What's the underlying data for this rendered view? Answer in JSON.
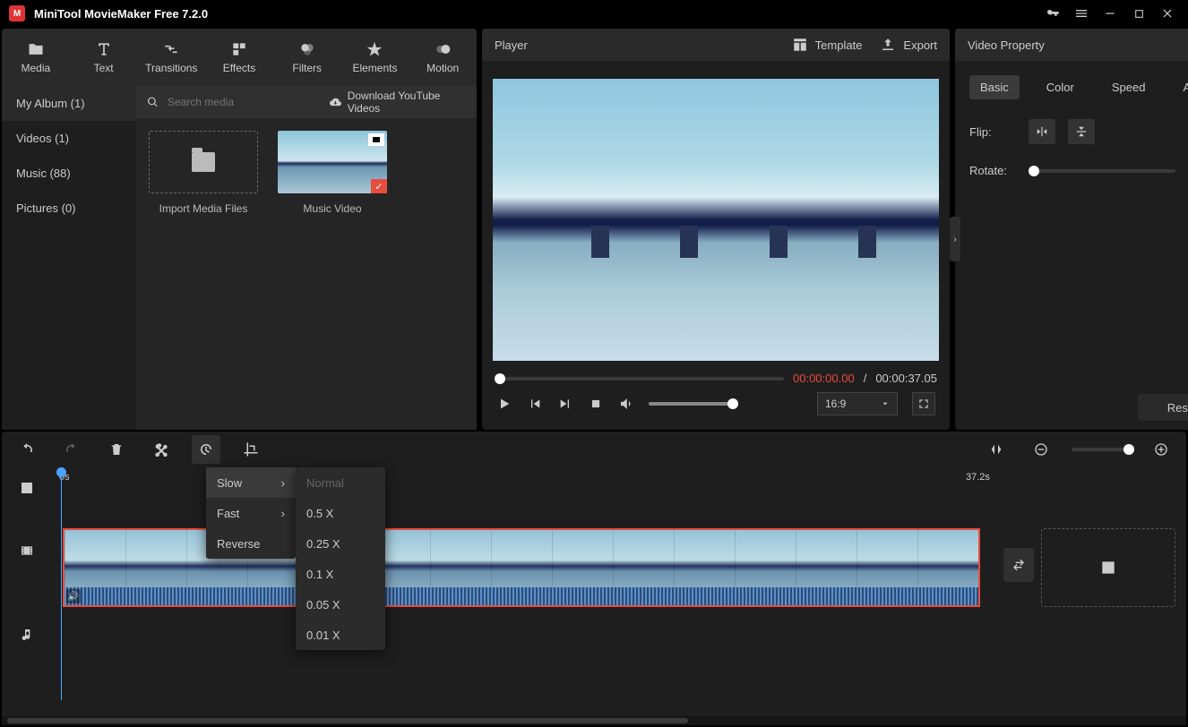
{
  "titlebar": {
    "title": "MiniTool MovieMaker Free 7.2.0"
  },
  "mainTabs": {
    "media": "Media",
    "text": "Text",
    "transitions": "Transitions",
    "effects": "Effects",
    "filters": "Filters",
    "elements": "Elements",
    "motion": "Motion"
  },
  "albums": {
    "myAlbum": "My Album (1)",
    "videos": "Videos (1)",
    "music": "Music (88)",
    "pictures": "Pictures (0)"
  },
  "mediaToolbar": {
    "searchPlaceholder": "Search media",
    "downloadYoutube": "Download YouTube Videos"
  },
  "mediaCards": {
    "import": "Import Media Files",
    "clip1": "Music Video"
  },
  "player": {
    "title": "Player",
    "template": "Template",
    "export": "Export",
    "timeCurrent": "00:00:00.00",
    "timeSep": " / ",
    "timeTotal": "00:00:37.05",
    "aspect": "16:9"
  },
  "property": {
    "title": "Video Property",
    "tabs": {
      "basic": "Basic",
      "color": "Color",
      "speed": "Speed",
      "audio": "Audio"
    },
    "flipLabel": "Flip:",
    "rotateLabel": "Rotate:",
    "rotateValue": "0°",
    "reset": "Reset"
  },
  "timeline": {
    "rulerStart": "0s",
    "rulerEnd": "37.2s"
  },
  "speedMenu": {
    "slow": "Slow",
    "fast": "Fast",
    "reverse": "Reverse",
    "normal": "Normal",
    "x05": "0.5 X",
    "x025": "0.25 X",
    "x01": "0.1 X",
    "x005": "0.05 X",
    "x001": "0.01 X"
  }
}
